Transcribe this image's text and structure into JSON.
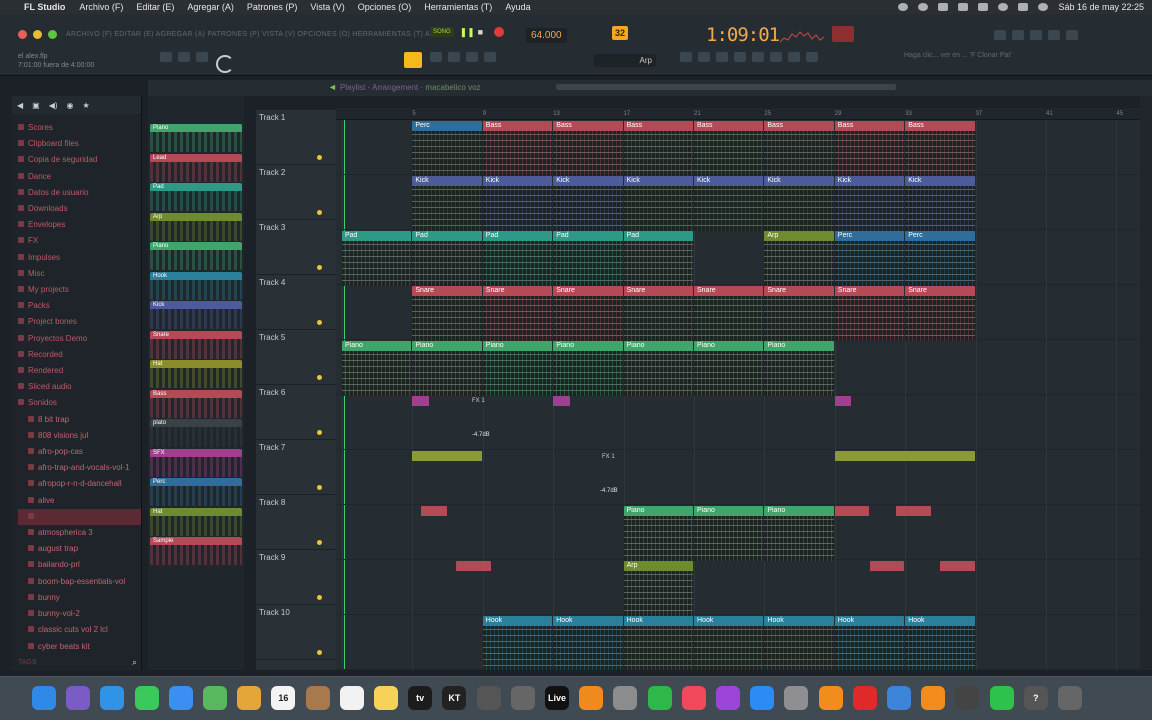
{
  "menubar": {
    "app_name": "FL Studio",
    "items": [
      "Archivo (F)",
      "Editar (E)",
      "Agregar (A)",
      "Patrones (P)",
      "Vista (V)",
      "Opciones (O)",
      "Herramientas (T)",
      "Ayuda"
    ],
    "clock": "Sáb 16 de may 22:25"
  },
  "toolbar": {
    "fl_menu": "ARCHIVO (F) EDITAR (E) AGREGAR (A) PATRONES (P) VISTA (V) OPCIONES (O) HERRAMIENTAS (T) AYUDA",
    "song_mode": "SONG",
    "tempo": "64.000",
    "pattern_num": "32",
    "time_display": "1:09:01",
    "song_name": "el alex.flp",
    "song_time": "7:01:00 fuera de 4:00:00",
    "pattern_select": "Arp",
    "hint": "Haga clic... ver en ... 'F Clonar Pat'",
    "accent": "#f2a94c"
  },
  "browser": {
    "items": [
      "Scores",
      "Clipboard files",
      "Copia de seguridad",
      "Dance",
      "Datos de usuario",
      "Downloads",
      "Envelopes",
      "FX",
      "Impulses",
      "Misc",
      "My projects",
      "Packs",
      "Project bones",
      "Proyectos Demo",
      "Recorded",
      "Rendered",
      "Sliced audio",
      "Sonidos"
    ],
    "sounds": [
      "8 bit trap",
      "808 visions jul",
      "afro-pop-cas",
      "afro-trap-and-vocals-vol-1",
      "afropop-r-n-d-dancehall",
      "alive",
      "",
      "atmospherica 3",
      "august trap",
      "bailando-prl",
      "boom-bap-essentials-vol",
      "bunny",
      "bunny-vol-2",
      "classic cuts vol 2 lcl",
      "cyber beats kit"
    ],
    "selected_index": 6,
    "tags_label": "TAGS"
  },
  "picker": {
    "items": [
      {
        "label": "Piano",
        "color": "#3fa56a"
      },
      {
        "label": "Lead",
        "color": "#b54a57"
      },
      {
        "label": "Pad",
        "color": "#2c9a87"
      },
      {
        "label": "Arp",
        "color": "#6f8b2f"
      },
      {
        "label": "Piano",
        "color": "#3fa56a"
      },
      {
        "label": "Hook",
        "color": "#2a7f9a"
      },
      {
        "label": "Kick",
        "color": "#4d5b9a"
      },
      {
        "label": "Snare",
        "color": "#b54a57"
      },
      {
        "label": "Hat",
        "color": "#8a8d2a"
      },
      {
        "label": "Bass",
        "color": "#b54a57"
      },
      {
        "label": "plato",
        "color": "#3a4248"
      },
      {
        "label": "SFX",
        "color": "#a13f8f"
      },
      {
        "label": "Perc",
        "color": "#2f6e9a"
      },
      {
        "label": "Hat",
        "color": "#6f8b2f"
      },
      {
        "label": "Sample",
        "color": "#b54a57"
      }
    ]
  },
  "playlist": {
    "title": "Playlist - Arrangement",
    "subtitle": "macabelico voz",
    "ruler": [
      "5",
      "9",
      "13",
      "17",
      "21",
      "25",
      "29",
      "33",
      "37",
      "41",
      "45"
    ],
    "tracks": [
      "Track 1",
      "Track 2",
      "Track 3",
      "Track 4",
      "Track 5",
      "Track 6",
      "Track 7",
      "Track 8",
      "Track 9",
      "Track 10"
    ],
    "clips": [
      {
        "name": "Perc",
        "bar": 5,
        "len": 4,
        "track": 0,
        "color": "#2f6e9a"
      },
      {
        "name": "Bass",
        "bar": 9,
        "len": 4,
        "track": 0,
        "color": "#b54a57"
      },
      {
        "name": "Bass",
        "bar": 13,
        "len": 4,
        "track": 0,
        "color": "#b54a57"
      },
      {
        "name": "Bass",
        "bar": 17,
        "len": 4,
        "track": 0,
        "color": "#b54a57"
      },
      {
        "name": "Bass",
        "bar": 21,
        "len": 4,
        "track": 0,
        "color": "#b54a57"
      },
      {
        "name": "Bass",
        "bar": 25,
        "len": 4,
        "track": 0,
        "color": "#b54a57"
      },
      {
        "name": "Bass",
        "bar": 29,
        "len": 4,
        "track": 0,
        "color": "#b54a57"
      },
      {
        "name": "Bass",
        "bar": 33,
        "len": 4,
        "track": 0,
        "color": "#b54a57"
      },
      {
        "name": "Kick",
        "bar": 5,
        "len": 4,
        "track": 1,
        "color": "#4d5b9a"
      },
      {
        "name": "Kick",
        "bar": 9,
        "len": 4,
        "track": 1,
        "color": "#4d5b9a"
      },
      {
        "name": "Kick",
        "bar": 13,
        "len": 4,
        "track": 1,
        "color": "#4d5b9a"
      },
      {
        "name": "Kick",
        "bar": 17,
        "len": 4,
        "track": 1,
        "color": "#4d5b9a"
      },
      {
        "name": "Kick",
        "bar": 21,
        "len": 4,
        "track": 1,
        "color": "#4d5b9a"
      },
      {
        "name": "Kick",
        "bar": 25,
        "len": 4,
        "track": 1,
        "color": "#4d5b9a"
      },
      {
        "name": "Kick",
        "bar": 29,
        "len": 4,
        "track": 1,
        "color": "#4d5b9a"
      },
      {
        "name": "Kick",
        "bar": 33,
        "len": 4,
        "track": 1,
        "color": "#4d5b9a"
      },
      {
        "name": "Pad",
        "bar": 1,
        "len": 4,
        "track": 2,
        "color": "#2c9a87"
      },
      {
        "name": "Pad",
        "bar": 5,
        "len": 4,
        "track": 2,
        "color": "#2c9a87"
      },
      {
        "name": "Pad",
        "bar": 9,
        "len": 4,
        "track": 2,
        "color": "#2c9a87"
      },
      {
        "name": "Pad",
        "bar": 13,
        "len": 4,
        "track": 2,
        "color": "#2c9a87"
      },
      {
        "name": "Pad",
        "bar": 17,
        "len": 4,
        "track": 2,
        "color": "#2c9a87"
      },
      {
        "name": "Arp",
        "bar": 25,
        "len": 4,
        "track": 2,
        "color": "#6f8b2f"
      },
      {
        "name": "Perc",
        "bar": 29,
        "len": 4,
        "track": 2,
        "color": "#2f6e9a"
      },
      {
        "name": "Perc",
        "bar": 33,
        "len": 4,
        "track": 2,
        "color": "#2f6e9a"
      },
      {
        "name": "Snare",
        "bar": 5,
        "len": 4,
        "track": 3,
        "color": "#b54a57"
      },
      {
        "name": "Snare",
        "bar": 9,
        "len": 4,
        "track": 3,
        "color": "#b54a57"
      },
      {
        "name": "Snare",
        "bar": 13,
        "len": 4,
        "track": 3,
        "color": "#b54a57"
      },
      {
        "name": "Snare",
        "bar": 17,
        "len": 4,
        "track": 3,
        "color": "#b54a57"
      },
      {
        "name": "Snare",
        "bar": 21,
        "len": 4,
        "track": 3,
        "color": "#b54a57"
      },
      {
        "name": "Snare",
        "bar": 25,
        "len": 4,
        "track": 3,
        "color": "#b54a57"
      },
      {
        "name": "Snare",
        "bar": 29,
        "len": 4,
        "track": 3,
        "color": "#b54a57"
      },
      {
        "name": "Snare",
        "bar": 33,
        "len": 4,
        "track": 3,
        "color": "#b54a57"
      },
      {
        "name": "Piano",
        "bar": 1,
        "len": 4,
        "track": 4,
        "color": "#3fa56a"
      },
      {
        "name": "Piano",
        "bar": 5,
        "len": 4,
        "track": 4,
        "color": "#3fa56a"
      },
      {
        "name": "Piano",
        "bar": 9,
        "len": 4,
        "track": 4,
        "color": "#3fa56a"
      },
      {
        "name": "Piano",
        "bar": 13,
        "len": 4,
        "track": 4,
        "color": "#3fa56a"
      },
      {
        "name": "Piano",
        "bar": 17,
        "len": 4,
        "track": 4,
        "color": "#3fa56a"
      },
      {
        "name": "Piano",
        "bar": 21,
        "len": 4,
        "track": 4,
        "color": "#3fa56a"
      },
      {
        "name": "Piano",
        "bar": 25,
        "len": 4,
        "track": 4,
        "color": "#3fa56a"
      },
      {
        "name": "Piano",
        "bar": 17,
        "len": 4,
        "track": 7,
        "color": "#3fa56a"
      },
      {
        "name": "Piano",
        "bar": 21,
        "len": 4,
        "track": 7,
        "color": "#3fa56a"
      },
      {
        "name": "Piano",
        "bar": 25,
        "len": 4,
        "track": 7,
        "color": "#3fa56a"
      },
      {
        "name": "Arp",
        "bar": 17,
        "len": 4,
        "track": 8,
        "color": "#6f8b2f"
      },
      {
        "name": "Hook",
        "bar": 9,
        "len": 4,
        "track": 9,
        "color": "#2a7f9a"
      },
      {
        "name": "Hook",
        "bar": 13,
        "len": 4,
        "track": 9,
        "color": "#2a7f9a"
      },
      {
        "name": "Hook",
        "bar": 17,
        "len": 4,
        "track": 9,
        "color": "#2a7f9a"
      },
      {
        "name": "Hook",
        "bar": 21,
        "len": 4,
        "track": 9,
        "color": "#2a7f9a"
      },
      {
        "name": "Hook",
        "bar": 25,
        "len": 4,
        "track": 9,
        "color": "#2a7f9a"
      },
      {
        "name": "Hook",
        "bar": 29,
        "len": 4,
        "track": 9,
        "color": "#2a7f9a"
      },
      {
        "name": "Hook",
        "bar": 33,
        "len": 4,
        "track": 9,
        "color": "#2a7f9a"
      }
    ],
    "short_clips": [
      {
        "bar": 5,
        "len": 1,
        "track": 5,
        "color": "#a13f8f"
      },
      {
        "bar": 13,
        "len": 1,
        "track": 5,
        "color": "#a13f8f"
      },
      {
        "bar": 29,
        "len": 1,
        "track": 5,
        "color": "#a13f8f"
      },
      {
        "bar": 5,
        "len": 4,
        "track": 6,
        "color": "#8a9a34"
      },
      {
        "bar": 29,
        "len": 8,
        "track": 6,
        "color": "#8a9a34"
      },
      {
        "bar": 5.5,
        "len": 1.5,
        "track": 7,
        "color": "#b54a57"
      },
      {
        "bar": 29,
        "len": 2,
        "track": 7,
        "color": "#b54a57"
      },
      {
        "bar": 32.5,
        "len": 2,
        "track": 7,
        "color": "#b54a57"
      },
      {
        "bar": 7.5,
        "len": 2,
        "track": 8,
        "color": "#b54a57"
      },
      {
        "bar": 31,
        "len": 2,
        "track": 8,
        "color": "#b54a57"
      },
      {
        "bar": 35,
        "len": 2,
        "track": 8,
        "color": "#b54a57"
      }
    ],
    "volume_labels": [
      "-4.7dB",
      "-4.7dB"
    ],
    "fx_labels": [
      "FX 1",
      "FX 1"
    ]
  },
  "dock": {
    "items": [
      {
        "name": "finder-icon",
        "color": "#2e8ae6",
        "glyph": ""
      },
      {
        "name": "launchpad-icon",
        "color": "#7a5cc4",
        "glyph": ""
      },
      {
        "name": "safari-icon",
        "color": "#2f93e8",
        "glyph": ""
      },
      {
        "name": "messages-icon",
        "color": "#3ac95a",
        "glyph": ""
      },
      {
        "name": "mail-icon",
        "color": "#3b8ff2",
        "glyph": ""
      },
      {
        "name": "maps-icon",
        "color": "#58b85d",
        "glyph": ""
      },
      {
        "name": "photos-icon",
        "color": "#e4a63a",
        "glyph": ""
      },
      {
        "name": "calendar-icon",
        "color": "#f4f4f4",
        "glyph": "16"
      },
      {
        "name": "contacts-icon",
        "color": "#a7794c",
        "glyph": ""
      },
      {
        "name": "reminders-icon",
        "color": "#f2f2f2",
        "glyph": ""
      },
      {
        "name": "notes-icon",
        "color": "#f6d258",
        "glyph": ""
      },
      {
        "name": "appletv-icon",
        "color": "#1c1c1c",
        "glyph": "tv"
      },
      {
        "name": "native-instruments-icon",
        "color": "#222",
        "glyph": "KT"
      },
      {
        "name": "mixer-icon",
        "color": "#555",
        "glyph": ""
      },
      {
        "name": "keyboard-icon",
        "color": "#666",
        "glyph": ""
      },
      {
        "name": "live-icon",
        "color": "#111",
        "glyph": "Live"
      },
      {
        "name": "logic-icon",
        "color": "#f08a1c",
        "glyph": ""
      },
      {
        "name": "system-prefs-icon",
        "color": "#8c8c8c",
        "glyph": ""
      },
      {
        "name": "facetime-icon",
        "color": "#2fb84a",
        "glyph": ""
      },
      {
        "name": "music-icon",
        "color": "#f2485b",
        "glyph": ""
      },
      {
        "name": "podcasts-icon",
        "color": "#9b46d9",
        "glyph": ""
      },
      {
        "name": "appstore-icon",
        "color": "#2b8cf5",
        "glyph": ""
      },
      {
        "name": "settings-icon",
        "color": "#8e8e93",
        "glyph": ""
      },
      {
        "name": "fl-studio-icon",
        "color": "#f28c1c",
        "glyph": ""
      },
      {
        "name": "opera-icon",
        "color": "#e02a2a",
        "glyph": ""
      },
      {
        "name": "chrome-icon",
        "color": "#3b84d9",
        "glyph": ""
      },
      {
        "name": "fl-studio-2-icon",
        "color": "#f28c1c",
        "glyph": ""
      },
      {
        "name": "mixer-2-icon",
        "color": "#444",
        "glyph": ""
      },
      {
        "name": "whatsapp-icon",
        "color": "#2dc24a",
        "glyph": ""
      },
      {
        "name": "help-icon",
        "color": "#555",
        "glyph": "?"
      },
      {
        "name": "trash-icon",
        "color": "#666",
        "glyph": ""
      }
    ]
  }
}
